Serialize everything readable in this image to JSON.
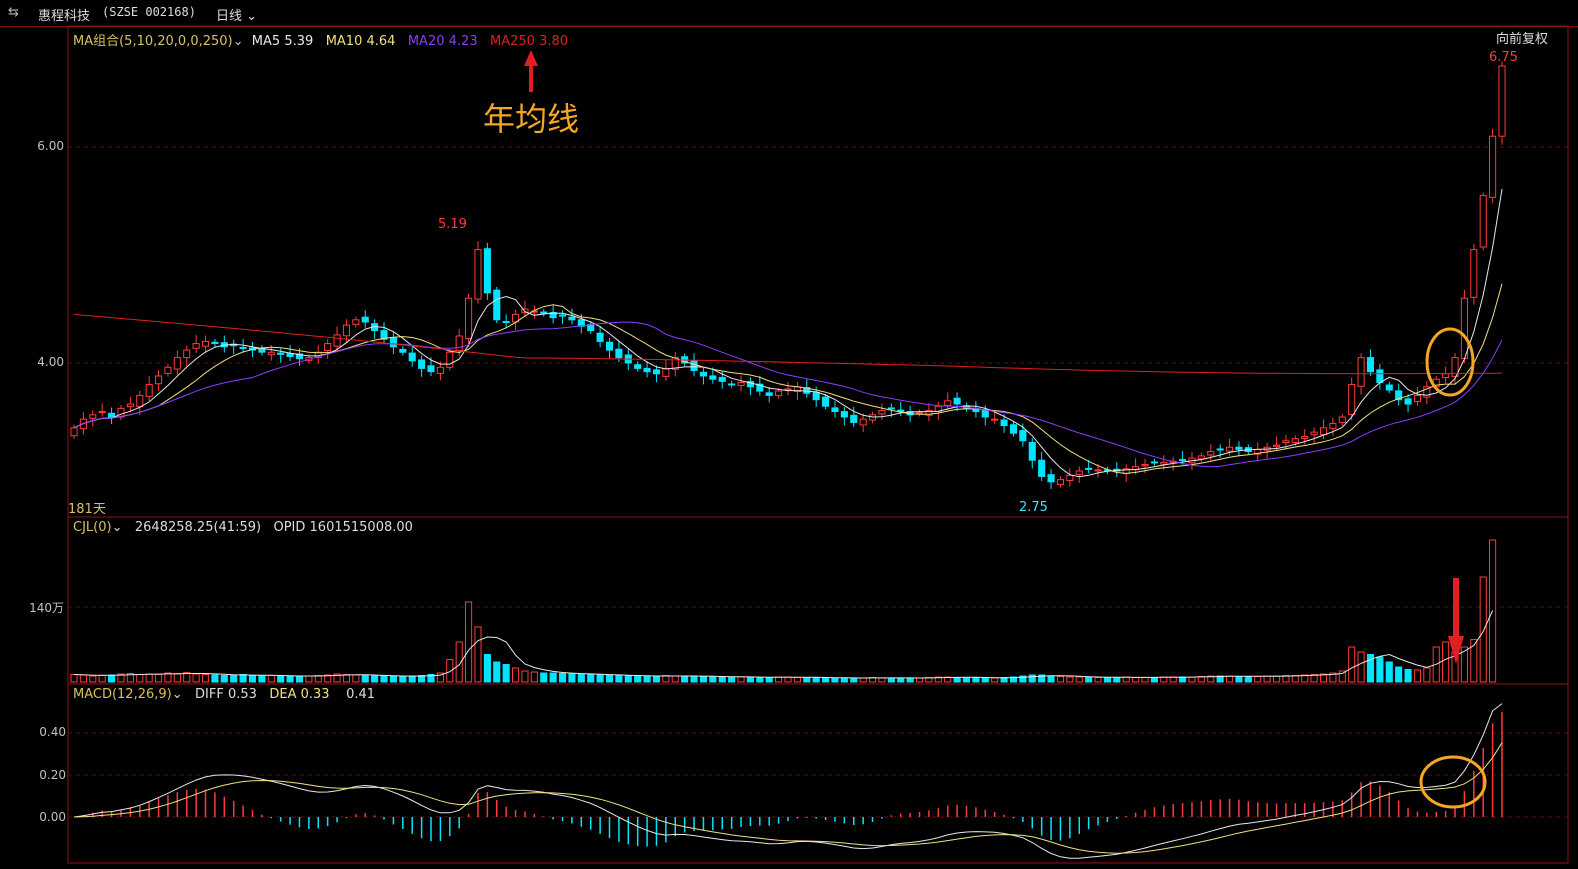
{
  "header": {
    "stock_name": "惠程科技",
    "stock_code": "(SZSE 002168)",
    "period": "日线",
    "adjust": "向前复权"
  },
  "ma_panel": {
    "title": "MA组合(5,10,20,0,0,250)",
    "items": [
      {
        "label": "MA5",
        "value": "5.39",
        "color": "#e8e8e8"
      },
      {
        "label": "MA10",
        "value": "4.64",
        "color": "#f0e080"
      },
      {
        "label": "MA20",
        "value": "4.23",
        "color": "#8a3cff"
      },
      {
        "label": "MA250",
        "value": "3.80",
        "color": "#e02020"
      }
    ],
    "annotation": "年均线",
    "y_ticks": [
      "6.00",
      "4.00"
    ],
    "high_label": "5.19",
    "low_label": "2.75",
    "last_high_label": "6.75",
    "days_label": "181天"
  },
  "volume_panel": {
    "title": "CJL(0)",
    "value": "2648258.25(41:59)",
    "opid": "OPID 1601515008.00",
    "y_tick": "140万"
  },
  "macd_panel": {
    "title": "MACD(12,26,9)",
    "diff": "DIFF 0.53",
    "dea": "DEA 0.33",
    "macd": "0.41",
    "y_ticks": [
      "0.40",
      "0.20",
      "0.00"
    ]
  },
  "colors": {
    "up": "#ff3b3b",
    "down": "#00e5ff",
    "frame": "#8b1414",
    "highlight": "#f5a623"
  },
  "chart_data": [
    {
      "type": "candlestick",
      "title": "",
      "ylim": [
        2.6,
        7.0
      ],
      "y_ticks": [
        4.0,
        6.0
      ],
      "series_ref": [
        "MA5",
        "MA10",
        "MA20",
        "MA250"
      ],
      "closes": [
        3.4,
        3.48,
        3.52,
        3.55,
        3.5,
        3.58,
        3.62,
        3.7,
        3.8,
        3.88,
        3.96,
        4.05,
        4.12,
        4.18,
        4.2,
        4.18,
        4.15,
        4.16,
        4.14,
        4.12,
        4.1,
        4.1,
        4.08,
        4.06,
        4.04,
        4.05,
        4.1,
        4.18,
        4.26,
        4.35,
        4.4,
        4.38,
        4.3,
        4.22,
        4.15,
        4.1,
        4.02,
        3.95,
        3.92,
        3.96,
        4.1,
        4.25,
        4.6,
        5.05,
        4.65,
        4.4,
        4.38,
        4.45,
        4.5,
        4.48,
        4.46,
        4.42,
        4.44,
        4.4,
        4.34,
        4.3,
        4.2,
        4.12,
        4.05,
        4.0,
        3.95,
        3.92,
        3.9,
        3.95,
        4.05,
        4.0,
        3.93,
        3.88,
        3.85,
        3.83,
        3.8,
        3.82,
        3.78,
        3.74,
        3.7,
        3.74,
        3.76,
        3.78,
        3.72,
        3.66,
        3.6,
        3.55,
        3.5,
        3.45,
        3.48,
        3.52,
        3.56,
        3.58,
        3.55,
        3.52,
        3.54,
        3.56,
        3.6,
        3.65,
        3.62,
        3.58,
        3.55,
        3.5,
        3.48,
        3.42,
        3.35,
        3.28,
        3.1,
        2.95,
        2.9,
        2.92,
        2.96,
        3.0,
        3.02,
        3.01,
        3.0,
        3.0,
        3.02,
        3.04,
        3.06,
        3.08,
        3.08,
        3.09,
        3.1,
        3.12,
        3.14,
        3.18,
        3.2,
        3.22,
        3.2,
        3.18,
        3.2,
        3.22,
        3.24,
        3.28,
        3.3,
        3.32,
        3.36,
        3.4,
        3.44,
        3.5,
        3.8,
        4.05,
        3.92,
        3.82,
        3.75,
        3.66,
        3.62,
        3.7,
        3.78,
        3.85,
        3.9,
        4.05,
        4.6,
        5.05,
        5.55,
        6.1,
        6.75
      ],
      "highs_marked": {
        "5.19": 43,
        "2.75": 104,
        "6.75": 150
      }
    },
    {
      "type": "bar",
      "title": "",
      "name": "CJL",
      "y_tick": 1400000,
      "ylim": [
        0,
        2800000
      ],
      "values": [
        15,
        14,
        12,
        13,
        14,
        16,
        17,
        15,
        16,
        15,
        18,
        17,
        19,
        16,
        15,
        14,
        13,
        14,
        15,
        13,
        12,
        13,
        12,
        12,
        11,
        12,
        13,
        14,
        16,
        15,
        14,
        13,
        12,
        12,
        12,
        11,
        12,
        13,
        15,
        18,
        45,
        80,
        160,
        110,
        55,
        40,
        35,
        28,
        22,
        20,
        18,
        18,
        17,
        16,
        15,
        15,
        14,
        14,
        13,
        12,
        12,
        11,
        12,
        13,
        12,
        12,
        11,
        11,
        11,
        10,
        10,
        10,
        10,
        9,
        9,
        10,
        10,
        9,
        9,
        9,
        8,
        8,
        8,
        8,
        8,
        9,
        8,
        8,
        8,
        8,
        8,
        9,
        10,
        10,
        9,
        9,
        9,
        8,
        8,
        9,
        10,
        12,
        14,
        14,
        12,
        11,
        10,
        10,
        10,
        9,
        9,
        9,
        10,
        9,
        9,
        9,
        10,
        10,
        10,
        10,
        11,
        12,
        12,
        12,
        11,
        11,
        11,
        12,
        12,
        13,
        13,
        14,
        15,
        16,
        18,
        22,
        70,
        60,
        55,
        50,
        40,
        30,
        25,
        24,
        28,
        70,
        80,
        60,
        70,
        85,
        210,
        290
      ]
    },
    {
      "type": "bar",
      "title": "",
      "name": "MACD",
      "ylim": [
        -0.22,
        0.54
      ],
      "y_ticks": [
        0.0,
        0.2,
        0.4
      ],
      "diff_final": 0.53,
      "dea_final": 0.33,
      "macd_final": 0.41
    }
  ]
}
